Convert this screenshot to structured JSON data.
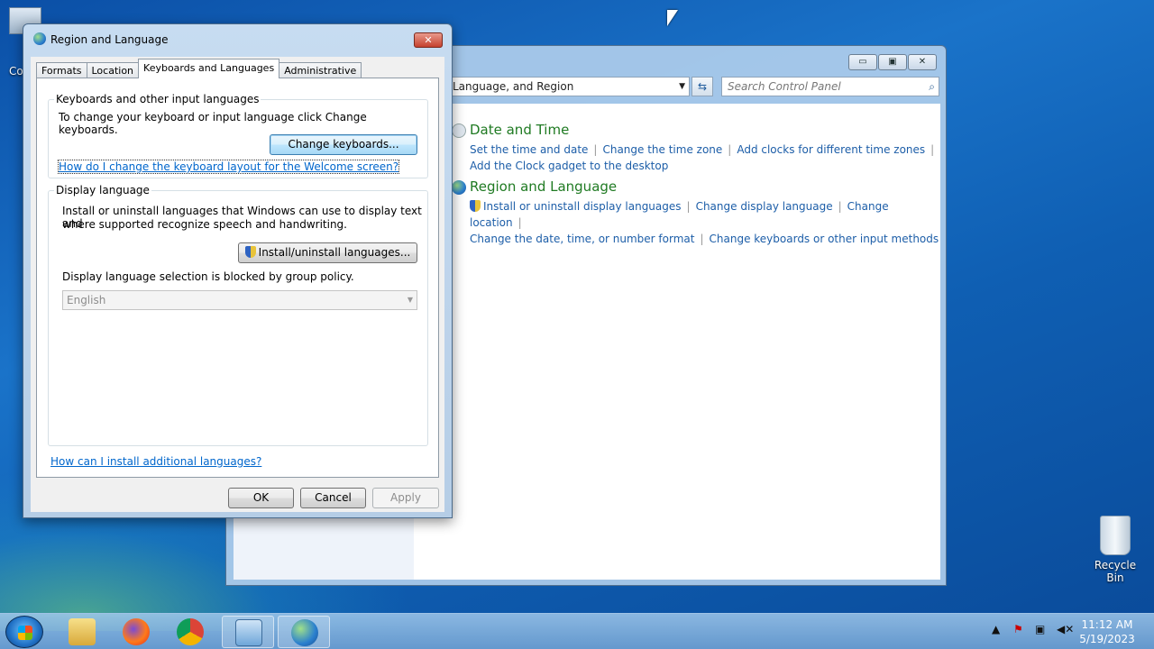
{
  "desktop": {
    "computer_label": "Co",
    "recycle_label": "Recycle Bin"
  },
  "control_panel": {
    "address": "Language, and Region",
    "search_placeholder": "Search Control Panel",
    "sections": [
      {
        "title": "Date and Time",
        "links_row1": [
          "Set the time and date",
          "Change the time zone",
          "Add clocks for different time zones"
        ],
        "links_row2": [
          "Add the Clock gadget to the desktop"
        ]
      },
      {
        "title": "Region and Language",
        "links_row1": [
          "Install or uninstall display languages",
          "Change display language",
          "Change location"
        ],
        "links_row2": [
          "Change the date, time, or number format",
          "Change keyboards or other input methods"
        ]
      }
    ]
  },
  "dialog": {
    "title": "Region and Language",
    "close_label": "✕",
    "tabs": [
      "Formats",
      "Location",
      "Keyboards and Languages",
      "Administrative"
    ],
    "active_tab": "Keyboards and Languages",
    "kb_group": {
      "label": "Keyboards and other input languages",
      "text": "To change your keyboard or input language click Change keyboards.",
      "button": "Change keyboards...",
      "link": "How do I change the keyboard layout for the Welcome screen?"
    },
    "display_group": {
      "label": "Display language",
      "text_line1": "Install or uninstall languages that Windows can use to display text and",
      "text_line2": "where supported recognize speech and handwriting.",
      "button": "Install/uninstall languages...",
      "blocked_text": "Display language selection is blocked by group policy.",
      "selected_language": "English"
    },
    "bottom_link": "How can I install additional languages?",
    "ok": "OK",
    "cancel": "Cancel",
    "apply": "Apply"
  },
  "taskbar": {
    "time": "11:12 AM",
    "date": "5/19/2023",
    "buttons": [
      "explorer",
      "firefox",
      "chrome",
      "control-panel",
      "region-and-language"
    ]
  }
}
